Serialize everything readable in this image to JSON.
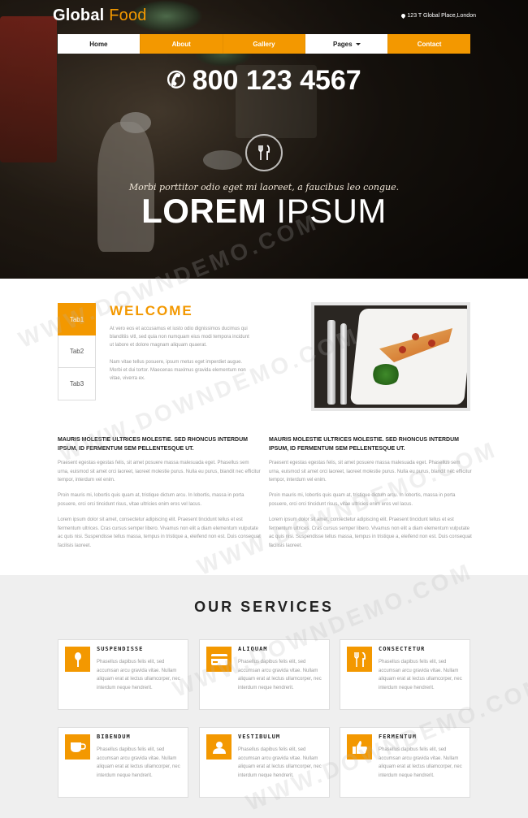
{
  "brand": {
    "name_primary": "Global",
    "name_secondary": "Food"
  },
  "header": {
    "address": "123 T Global Place,London"
  },
  "nav": {
    "items": [
      {
        "label": "Home"
      },
      {
        "label": "About"
      },
      {
        "label": "Gallery"
      },
      {
        "label": "Pages"
      },
      {
        "label": "Contact"
      }
    ]
  },
  "hero": {
    "phone": "800 123 4567",
    "tagline": "Morbi porttitor odio eget mi laoreet, a faucibus leo congue.",
    "headline_bold": "LOREM",
    "headline_thin": "IPSUM"
  },
  "welcome": {
    "tabs": [
      "Tab1",
      "Tab2",
      "Tab3"
    ],
    "title": "WELCOME",
    "paragraphs": [
      "At vero eos et accusamus et iusto odio dignissimos ducimus qui blanditiis vitl, sed quia non numquam eius modi tempora incidunt ut labore et dolore magnam aliquam quaerat.",
      "Nam vitae tellus posuere, ipsum metus eget imperdiet augue. Morbi et dui tortor. Maecenas maximus gravida elementum non vitae, viverra ex."
    ]
  },
  "columns": [
    {
      "title": "MAURIS MOLESTIE ULTRICES MOLESTIE. SED RHONCUS INTERDUM IPSUM, ID FERMENTUM SEM PELLENTESQUE UT.",
      "paragraphs": [
        "Praesent egestas egestas felis, sit amet posuere massa malesuada eget. Phasellus sem urna, euismod sit amet orci laoreet, laoreet molestie purus. Nulla eu purus, blandit nec efficitur tempor, interdum vel enim.",
        "Proin mauris mi, lobortis quis quam at, tristique dictum arcu. In lobortis, massa in porta posuere, orci orci tincidunt risus, vitae ultricies enim eros vel lacus.",
        "Lorem ipsum dolor sit amet, consectetur adipiscing elit. Praesent tincidunt tellus et est fermentum ultrices. Cras cursus semper libero. Vivamus non elit a diam elementum vulputate ac quis nisi. Suspendisse tellus massa, tempus in tristique a, eleifend non est. Duis consequat facilisis laoreet."
      ]
    },
    {
      "title": "MAURIS MOLESTIE ULTRICES MOLESTIE. SED RHONCUS INTERDUM IPSUM, ID FERMENTUM SEM PELLENTESQUE UT.",
      "paragraphs": [
        "Praesent egestas egestas felis, sit amet posuere massa malesuada eget. Phasellus sem urna, euismod sit amet orci laoreet, laoreet molestie purus. Nulla eu purus, blandit nec efficitur tempor, interdum vel enim.",
        "Proin mauris mi, lobortis quis quam at, tristique dictum arcu. In lobortis, massa in porta posuere, orci orci tincidunt risus, vitae ultricies enim eros vel lacus.",
        "Lorem ipsum dolor sit amet, consectetur adipiscing elit. Praesent tincidunt tellus et est fermentum ultrices. Cras cursus semper libero. Vivamus non elit a diam elementum vulputate ac quis nisi. Suspendisse tellus massa, tempus in tristique a, eleifend non est. Duis consequat facilisis laoreet."
      ]
    }
  ],
  "services": {
    "title": "OUR SERVICES",
    "cards": [
      {
        "icon": "spoon-icon",
        "title": "SUSPENDISSE",
        "text": "Phasellus dapibus felis elit, sed accumsan arcu gravida vitae. Nullam aliquam erat at lectus ullamcorper, nec interdum neque hendrerit."
      },
      {
        "icon": "credit-card-icon",
        "title": "ALIQUAM",
        "text": "Phasellus dapibus felis elit, sed accumsan arcu gravida vitae. Nullam aliquam erat at lectus ullamcorper, nec interdum neque hendrerit."
      },
      {
        "icon": "fork-knife-icon",
        "title": "CONSECTETUR",
        "text": "Phasellus dapibus felis elit, sed accumsan arcu gravida vitae. Nullam aliquam erat at lectus ullamcorper, nec interdum neque hendrerit."
      },
      {
        "icon": "coffee-cup-icon",
        "title": "BIBENDUM",
        "text": "Phasellus dapibus felis elit, sed accumsan arcu gravida vitae. Nullam aliquam erat at lectus ullamcorper, nec interdum neque hendrerit."
      },
      {
        "icon": "user-icon",
        "title": "VESTIBULUM",
        "text": "Phasellus dapibus felis elit, sed accumsan arcu gravida vitae. Nullam aliquam erat at lectus ullamcorper, nec interdum neque hendrerit."
      },
      {
        "icon": "thumbs-up-icon",
        "title": "FERMENTUM",
        "text": "Phasellus dapibus felis elit, sed accumsan arcu gravida vitae. Nullam aliquam erat at lectus ullamcorper, nec interdum neque hendrerit."
      }
    ]
  },
  "watermark": {
    "text": "WWW.DOWNDEMO.COM"
  },
  "colors": {
    "accent": "#f39800",
    "dark": "#222222",
    "muted": "#999999",
    "section_bg": "#efefef"
  }
}
